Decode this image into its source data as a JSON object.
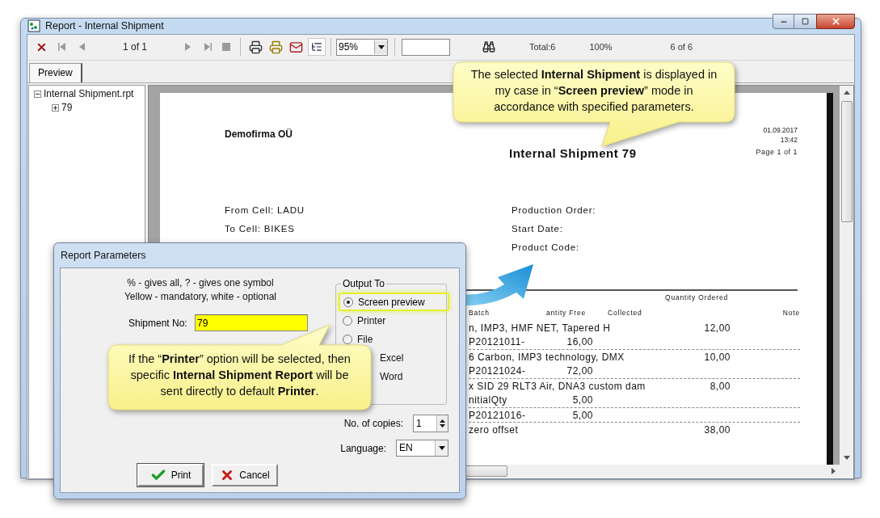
{
  "window": {
    "title": "Report - Internal Shipment"
  },
  "toolbar": {
    "page": "1 of 1",
    "zoom": "95%",
    "total": "Total:6",
    "percent": "100%",
    "record": "6 of 6",
    "tree_toggle_on": true
  },
  "tabs": [
    {
      "label": "Preview",
      "selected": true
    }
  ],
  "tree": [
    {
      "label": "Internal Shipment.rpt",
      "expanded": true,
      "children": [
        {
          "label": "79",
          "expanded": false
        }
      ]
    }
  ],
  "report": {
    "company": "Demofirma OÜ",
    "title": "Internal Shipment 79",
    "date": "01.09.2017",
    "time": "13:42",
    "page": "Page 1 of 1",
    "fields_left": [
      "From Cell: LADU",
      "To Cell: BIKES"
    ],
    "fields_right": [
      "Production Order:",
      "Start Date:",
      "Product Code:"
    ],
    "column_group": "Quantity Ordered",
    "columns": [
      "Batch",
      "antity Free",
      "Collected",
      "Note"
    ],
    "rows": [
      {
        "description": "n, IMP3, HMF NET, Tapered H",
        "ordered": "12,00",
        "batches": [
          {
            "batch": "P20121011-",
            "free": "16,00"
          }
        ]
      },
      {
        "description": "6 Carbon, IMP3 technology, DMX",
        "ordered": "10,00",
        "batches": [
          {
            "batch": "P20121024-",
            "free": "72,00"
          }
        ]
      },
      {
        "description": "x SID 29 RLT3 Air, DNA3 custom dam",
        "ordered": "8,00",
        "batches": [
          {
            "batch": "nitialQty",
            "free": "5,00"
          },
          {
            "batch": "P20121016-",
            "free": "5,00"
          }
        ]
      },
      {
        "description": "zero offset",
        "ordered": "38,00",
        "batches": []
      }
    ]
  },
  "dialog": {
    "title": "Report Parameters",
    "hints": [
      "% - gives all, ? - gives one symbol",
      "Yellow - mandatory, white - optional"
    ],
    "shipment": {
      "label": "Shipment No:",
      "value": "79"
    },
    "output": {
      "label": "Output To",
      "options": [
        {
          "label": "Screen preview",
          "selected": true,
          "highlighted": true,
          "kind": "radio"
        },
        {
          "label": "Printer",
          "selected": false,
          "highlighted": false,
          "kind": "radio"
        },
        {
          "label": "File",
          "selected": false,
          "highlighted": false,
          "kind": "radio"
        },
        {
          "label": "Excel",
          "selected": false,
          "highlighted": false,
          "kind": "covered"
        },
        {
          "label": "Word",
          "selected": false,
          "highlighted": false,
          "kind": "covered"
        }
      ]
    },
    "copies": {
      "label": "No. of copies:",
      "value": "1"
    },
    "language": {
      "label": "Language:",
      "value": "EN"
    },
    "buttons": [
      {
        "label": "Print",
        "kind": "ok"
      },
      {
        "label": "Cancel",
        "kind": "cancel"
      }
    ]
  },
  "callouts": [
    {
      "kind": "down",
      "text": "The selected **Internal Shipment** is displayed in my case in “**Screen preview**” mode in accordance with specified parameters."
    },
    {
      "kind": "up",
      "text": "If the “**Printer**” option will be selected, then specific **Internal Shipment Report** will be sent directly to default **Printer**."
    }
  ]
}
